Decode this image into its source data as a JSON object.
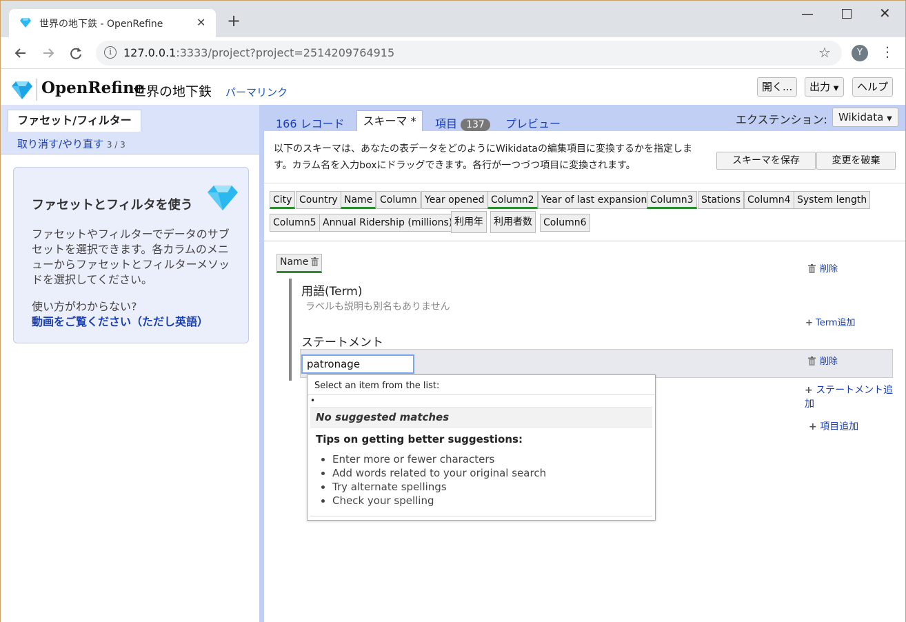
{
  "browser": {
    "tab_title": "世界の地下鉄 - OpenRefine",
    "tab_close": "✕",
    "new_tab": "+",
    "url_host": "127.0.0.1",
    "url_rest": ":3333/project?project=2514209764915",
    "avatar_letter": "Y"
  },
  "header": {
    "app_name": "OpenRefine",
    "project_name": "世界の地下鉄",
    "permalink": "パーマリンク",
    "open_btn": "開く...",
    "export_btn": "出力",
    "help_btn": "ヘルプ"
  },
  "left": {
    "tab": "ファセット/フィルター",
    "undo": "取り消す/やり直す",
    "undo_count": "3 / 3",
    "help_title": "ファセットとフィルタを使う",
    "help_body": "ファセットやフィルターでデータのサブセットを選択できます。各カラムのメニューからファセットとフィルターメソッドを選択してください。",
    "help_question": "使い方がわからない?",
    "help_video": "動画をご覧ください（ただし英語）"
  },
  "tabs": {
    "records": "166 レコード",
    "schema": "スキーマ *",
    "items": "項目",
    "items_count": "137",
    "preview": "プレビュー",
    "extension_label": "エクステンション:",
    "extension_value": "Wikidata"
  },
  "schema": {
    "description": "以下のスキーマは、あなたの表データをどのようにWikidataの編集項目に変換するかを指定します。カラム名を入力boxにドラッグできます。各行が一つづつ項目に変換されます。",
    "save_btn": "スキーマを保存",
    "discard_btn": "変更を破棄",
    "columns": [
      {
        "label": "City",
        "used": true
      },
      {
        "label": "Country",
        "used": false
      },
      {
        "label": "Name",
        "used": true
      },
      {
        "label": "Column",
        "used": false
      },
      {
        "label": "Year opened",
        "used": false
      },
      {
        "label": "Column2",
        "used": true
      },
      {
        "label": "Year of last expansion",
        "used": false
      },
      {
        "label": "Column3",
        "used": true
      },
      {
        "label": "Stations",
        "used": false
      },
      {
        "label": "Column4",
        "used": false
      },
      {
        "label": "System length",
        "used": false
      },
      {
        "label": "Column5",
        "used": false
      },
      {
        "label": "Annual Ridership (millions)",
        "used": false
      },
      {
        "label": "利用年",
        "used": false
      },
      {
        "label": "利用者数",
        "used": false
      },
      {
        "label": "Column6",
        "used": false
      }
    ],
    "subject_column": "Name",
    "delete_label": "削除",
    "term_heading": "用語(Term)",
    "term_empty": "ラベルも説明も別名もありません",
    "add_term": "Term追加",
    "statement_heading": "ステートメント",
    "property_input_value": "patronage",
    "add_statement": "ステートメント追加",
    "add_item": "項目追加"
  },
  "suggest": {
    "header": "Select an item from the list:",
    "bullet": "•",
    "no_match": "No suggested matches",
    "tips_title": "Tips on getting better suggestions:",
    "tips": [
      "Enter more or fewer characters",
      "Add words related to your original search",
      "Try alternate spellings",
      "Check your spelling"
    ]
  },
  "icons": {
    "favicon": "diamond-icon",
    "back": "back-arrow-icon",
    "forward": "forward-arrow-icon",
    "reload": "reload-icon",
    "info": "info-icon",
    "star": "star-icon",
    "menu": "kebab-menu-icon",
    "trash": "trash-icon"
  },
  "colors": {
    "brand_diamond": "#2bb7f0",
    "link_blue": "#1a3fb3",
    "tab_bar": "#c2cff4",
    "left_tab_bar": "#dbe3fa",
    "used_column_underline": "#2e8b2e"
  }
}
